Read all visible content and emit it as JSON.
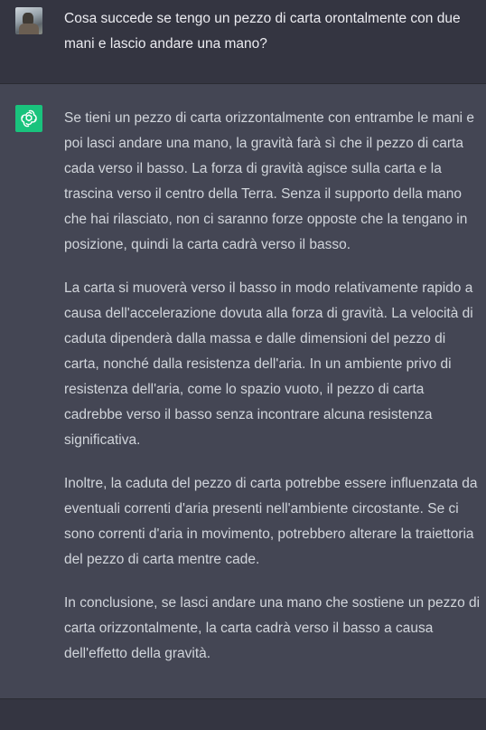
{
  "user_message": {
    "text": "Cosa succede se tengo un pezzo di carta orontalmente con due mani e lascio andare una mano?"
  },
  "assistant_message": {
    "paragraphs": [
      "Se tieni un pezzo di carta orizzontalmente con entrambe le mani e poi lasci andare una mano, la gravità farà sì che il pezzo di carta cada verso il basso. La forza di gravità agisce sulla carta e la trascina verso il centro della Terra. Senza il supporto della mano che hai rilasciato, non ci saranno forze opposte che la tengano in posizione, quindi la carta cadrà verso il basso.",
      "La carta si muoverà verso il basso in modo relativamente rapido a causa dell'accelerazione dovuta alla forza di gravità. La velocità di caduta dipenderà dalla massa e dalle dimensioni del pezzo di carta, nonché dalla resistenza dell'aria. In un ambiente privo di resistenza dell'aria, come lo spazio vuoto, il pezzo di carta cadrebbe verso il basso senza incontrare alcuna resistenza significativa.",
      "Inoltre, la caduta del pezzo di carta potrebbe essere influenzata da eventuali correnti d'aria presenti nell'ambiente circostante. Se ci sono correnti d'aria in movimento, potrebbero alterare la traiettoria del pezzo di carta mentre cade.",
      "In conclusione, se lasci andare una mano che sostiene un pezzo di carta orizzontalmente, la carta cadrà verso il basso a causa dell'effetto della gravità."
    ]
  },
  "icons": {
    "user_avatar": "user-avatar-photo",
    "assistant_avatar": "openai-logo-icon"
  },
  "colors": {
    "background": "#343541",
    "assistant_background": "#444654",
    "avatar_green": "#19c37d",
    "text": "#d1d5db"
  }
}
